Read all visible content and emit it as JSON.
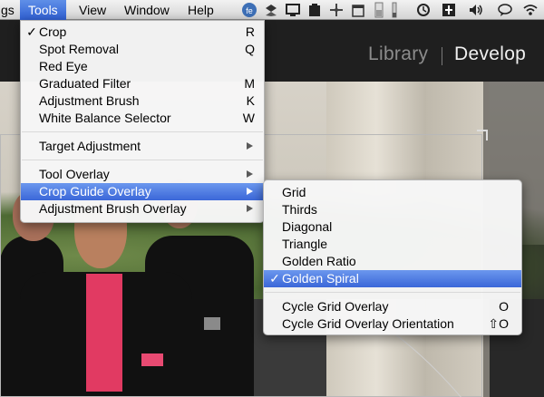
{
  "menubar": {
    "items": [
      {
        "label": "gs"
      },
      {
        "label": "Tools"
      },
      {
        "label": "View"
      },
      {
        "label": "Window"
      },
      {
        "label": "Help"
      }
    ],
    "status_icons": [
      "app-badge-icon",
      "dropbox-icon",
      "screen-icon",
      "clipboard-icon",
      "move-icon",
      "calendar-icon",
      "memory-meter-icon",
      "wifi-indicator-icon",
      "time-machine-icon",
      "menu-extra-icon",
      "volume-icon",
      "speech-icon",
      "wifi-icon"
    ]
  },
  "app": {
    "modules": {
      "library": "Library",
      "develop": "Develop"
    }
  },
  "tools_menu": {
    "items": [
      {
        "label": "Crop",
        "shortcut": "R",
        "checked": "✓"
      },
      {
        "label": "Spot Removal",
        "shortcut": "Q"
      },
      {
        "label": "Red Eye",
        "shortcut": ""
      },
      {
        "label": "Graduated Filter",
        "shortcut": "M"
      },
      {
        "label": "Adjustment Brush",
        "shortcut": "K"
      },
      {
        "label": "White Balance Selector",
        "shortcut": "W"
      },
      {
        "label": "Target Adjustment"
      },
      {
        "label": "Tool Overlay"
      },
      {
        "label": "Crop Guide Overlay"
      },
      {
        "label": "Adjustment Brush Overlay"
      }
    ]
  },
  "crop_guide_menu": {
    "items": [
      {
        "label": "Grid"
      },
      {
        "label": "Thirds"
      },
      {
        "label": "Diagonal"
      },
      {
        "label": "Triangle"
      },
      {
        "label": "Golden Ratio"
      },
      {
        "label": "Golden Spiral",
        "checked": "✓"
      },
      {
        "label": "Cycle Grid Overlay",
        "shortcut": "O"
      },
      {
        "label": "Cycle Grid Overlay Orientation",
        "shortcut": "⇧O"
      }
    ]
  }
}
